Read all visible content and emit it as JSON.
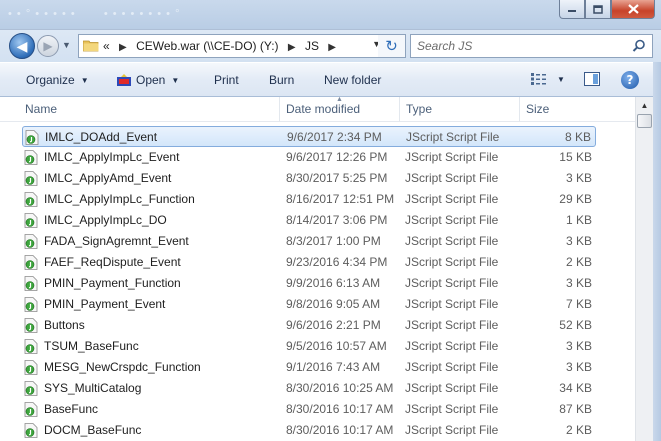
{
  "window": {
    "title_ghost": [
      "• • ° • • • • •",
      "• • • • • • • • °"
    ],
    "icons": {
      "minimize": "minimize-icon",
      "maximize": "maximize-icon",
      "close": "close-icon"
    }
  },
  "address": {
    "overflow": "«",
    "crumbs": [
      "CEWeb.war (\\\\CE-DO) (Y:)",
      "JS"
    ],
    "search_placeholder": "Search JS"
  },
  "toolbar": {
    "organize": "Organize",
    "open": "Open",
    "print": "Print",
    "burn": "Burn",
    "new_folder": "New folder"
  },
  "columns": {
    "name": "Name",
    "date": "Date modified",
    "type": "Type",
    "size": "Size"
  },
  "files": [
    {
      "name": "IMLC_DOAdd_Event",
      "date": "9/6/2017 2:34 PM",
      "type": "JScript Script File",
      "size": "8 KB",
      "selected": true
    },
    {
      "name": "IMLC_ApplyImpLc_Event",
      "date": "9/6/2017 12:26 PM",
      "type": "JScript Script File",
      "size": "15 KB"
    },
    {
      "name": "IMLC_ApplyAmd_Event",
      "date": "8/30/2017 5:25 PM",
      "type": "JScript Script File",
      "size": "3 KB"
    },
    {
      "name": "IMLC_ApplyImpLc_Function",
      "date": "8/16/2017 12:51 PM",
      "type": "JScript Script File",
      "size": "29 KB"
    },
    {
      "name": "IMLC_ApplyImpLc_DO",
      "date": "8/14/2017 3:06 PM",
      "type": "JScript Script File",
      "size": "1 KB"
    },
    {
      "name": "FADA_SignAgremnt_Event",
      "date": "8/3/2017 1:00 PM",
      "type": "JScript Script File",
      "size": "3 KB"
    },
    {
      "name": "FAEF_ReqDispute_Event",
      "date": "9/23/2016 4:34 PM",
      "type": "JScript Script File",
      "size": "2 KB"
    },
    {
      "name": "PMIN_Payment_Function",
      "date": "9/9/2016 6:13 AM",
      "type": "JScript Script File",
      "size": "3 KB"
    },
    {
      "name": "PMIN_Payment_Event",
      "date": "9/8/2016 9:05 AM",
      "type": "JScript Script File",
      "size": "7 KB"
    },
    {
      "name": "Buttons",
      "date": "9/6/2016 2:21 PM",
      "type": "JScript Script File",
      "size": "52 KB"
    },
    {
      "name": "TSUM_BaseFunc",
      "date": "9/5/2016 10:57 AM",
      "type": "JScript Script File",
      "size": "3 KB"
    },
    {
      "name": "MESG_NewCrspdc_Function",
      "date": "9/1/2016 7:43 AM",
      "type": "JScript Script File",
      "size": "3 KB"
    },
    {
      "name": "SYS_MultiCatalog",
      "date": "8/30/2016 10:25 AM",
      "type": "JScript Script File",
      "size": "34 KB"
    },
    {
      "name": "BaseFunc",
      "date": "8/30/2016 10:17 AM",
      "type": "JScript Script File",
      "size": "87 KB"
    },
    {
      "name": "DOCM_BaseFunc",
      "date": "8/30/2016 10:17 AM",
      "type": "JScript Script File",
      "size": "2 KB"
    }
  ],
  "colors": {
    "selection_border": "#84acdd",
    "selection_fill": "#d3e6fa",
    "chrome": "#c9d9ec",
    "text_secondary": "#5d5d5d"
  }
}
